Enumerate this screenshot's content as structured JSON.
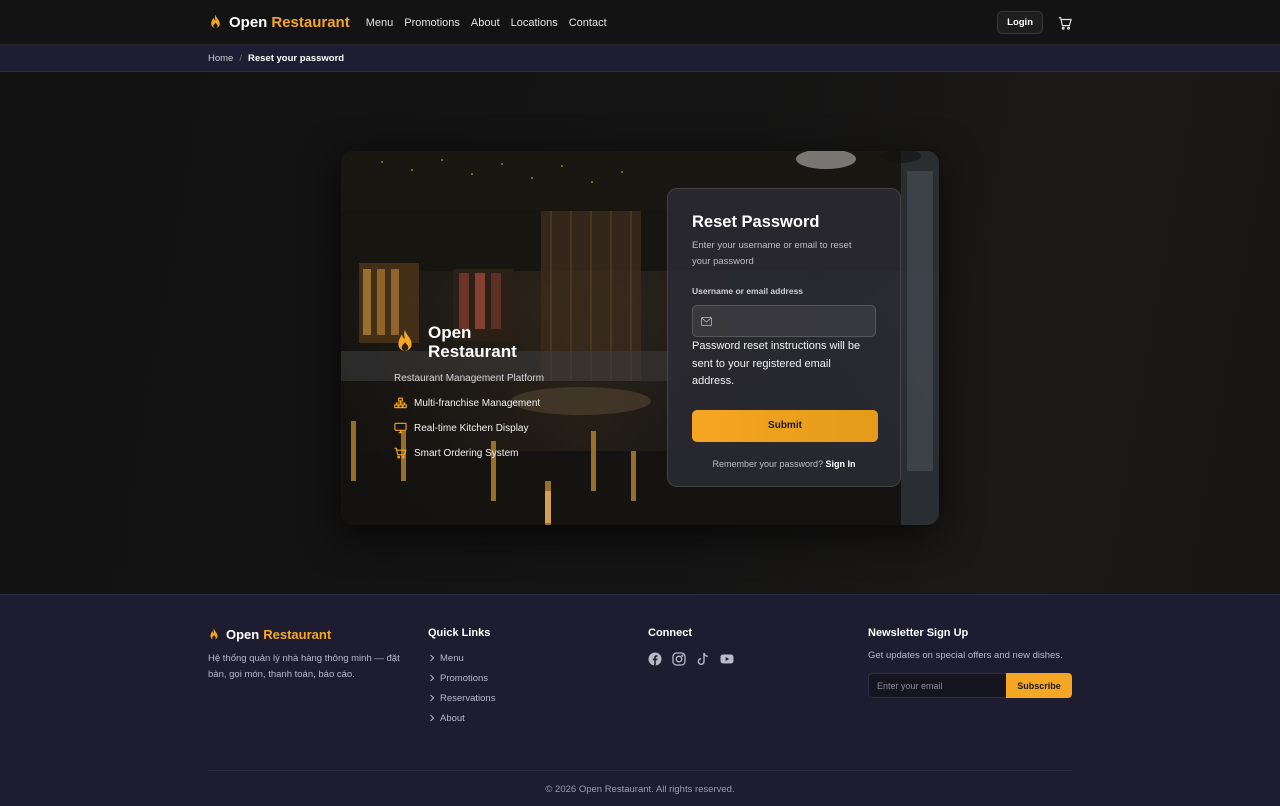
{
  "navbar": {
    "brand_main": "Open",
    "brand_accent": "Restaurant",
    "links": [
      "Menu",
      "Promotions",
      "About",
      "Locations",
      "Contact"
    ],
    "login_label": "Login"
  },
  "breadcrumb": {
    "home": "Home",
    "separator": "/",
    "current": "Reset your password"
  },
  "card": {
    "brand_text": "Open Restaurant",
    "subtitle": "Restaurant Management Platform",
    "features": [
      {
        "icon": "sitemap-icon",
        "label": "Multi-franchise Management"
      },
      {
        "icon": "monitor-icon",
        "label": "Real-time Kitchen Display"
      },
      {
        "icon": "cart-icon",
        "label": "Smart Ordering System"
      }
    ]
  },
  "form": {
    "title": "Reset Password",
    "description": "Enter your username or email to reset your password",
    "field_label": "Username or email address",
    "field_value": "",
    "field_placeholder": "",
    "help": "Password reset instructions will be sent to your registered email address.",
    "submit_label": "Submit",
    "remember_text": "Remember your password?",
    "sign_in_label": "Sign In"
  },
  "footer": {
    "brand_main": "Open",
    "brand_accent": "Restaurant",
    "about": "Hệ thống quản lý nhà hàng thông minh — đặt bàn, gọi món, thanh toán, báo cáo.",
    "quick_links_title": "Quick Links",
    "quick_links": [
      "Menu",
      "Promotions",
      "Reservations",
      "About"
    ],
    "connect_title": "Connect",
    "socials": [
      "facebook-icon",
      "instagram-icon",
      "tiktok-icon",
      "youtube-icon"
    ],
    "newsletter_title": "Newsletter Sign Up",
    "newsletter_desc": "Get updates on special offers and new dishes.",
    "newsletter_placeholder": "Enter your email",
    "subscribe_label": "Subscribe",
    "copyright": "© 2026 Open Restaurant. All rights reserved."
  },
  "colors": {
    "accent": "#f5a623",
    "nav_bg": "#131313",
    "breadcrumb_bg": "#1d1d34",
    "footer_bg": "#1d1c31",
    "page_bg": "#111111"
  }
}
